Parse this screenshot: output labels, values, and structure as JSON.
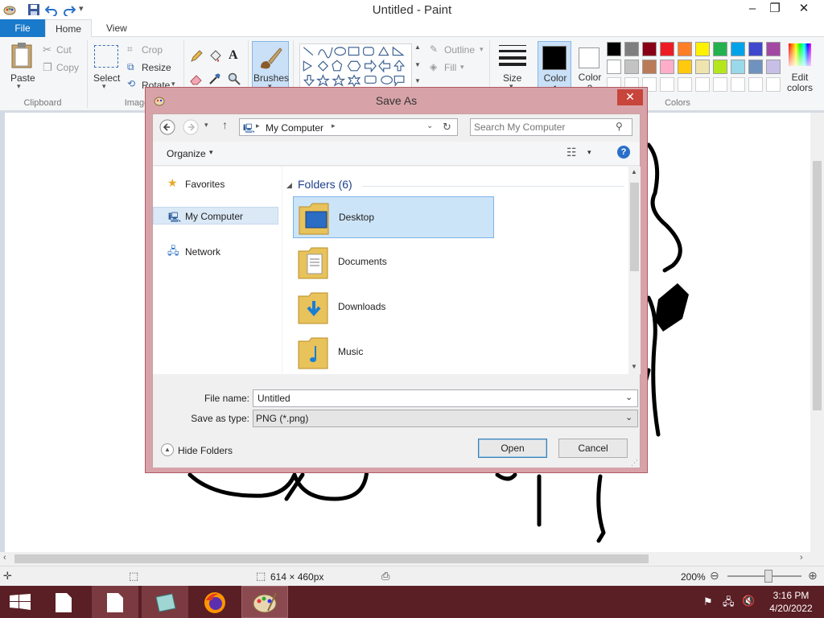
{
  "window": {
    "title": "Untitled - Paint",
    "minimize": "–",
    "restore": "❐",
    "close": "✕"
  },
  "tabs": {
    "file": "File",
    "home": "Home",
    "view": "View"
  },
  "ribbon": {
    "clipboard": {
      "paste": "Paste",
      "cut": "Cut",
      "copy": "Copy",
      "label": "Clipboard"
    },
    "image": {
      "select": "Select",
      "crop": "Crop",
      "resize": "Resize",
      "rotate": "Rotate",
      "label": "Image"
    },
    "brushes": "Brushes",
    "shapes": {
      "outline": "Outline",
      "fill": "Fill"
    },
    "size": "Size",
    "color1": "Color 1",
    "color2": "Color 2",
    "edit_colors": "Edit colors",
    "colors_label": "Colors",
    "palette_row1": [
      "#000000",
      "#7f7f7f",
      "#880015",
      "#ed1c24",
      "#ff7f27",
      "#fff200",
      "#22b14c",
      "#00a2e8",
      "#3f48cc",
      "#a349a4"
    ],
    "palette_row2": [
      "#ffffff",
      "#c3c3c3",
      "#b97a57",
      "#ffaec9",
      "#ffc90e",
      "#efe4b0",
      "#b5e61d",
      "#99d9ea",
      "#7092be",
      "#c8bfe7"
    ]
  },
  "dialog": {
    "title": "Save As",
    "close": "✕",
    "address": "My Computer",
    "search_placeholder": "Search My Computer",
    "organize": "Organize",
    "nav": {
      "favorites": "Favorites",
      "my_computer": "My Computer",
      "network": "Network"
    },
    "folders_header": "Folders (6)",
    "folders": [
      "Desktop",
      "Documents",
      "Downloads",
      "Music"
    ],
    "file_name_label": "File name:",
    "file_name_value": "Untitled",
    "save_type_label": "Save as type:",
    "save_type_value": "PNG (*.png)",
    "hide_folders": "Hide Folders",
    "open": "Open",
    "cancel": "Cancel"
  },
  "status": {
    "dimensions": "614 × 460px",
    "zoom": "200%"
  },
  "taskbar": {
    "time": "3:16 PM",
    "date": "4/20/2022"
  }
}
